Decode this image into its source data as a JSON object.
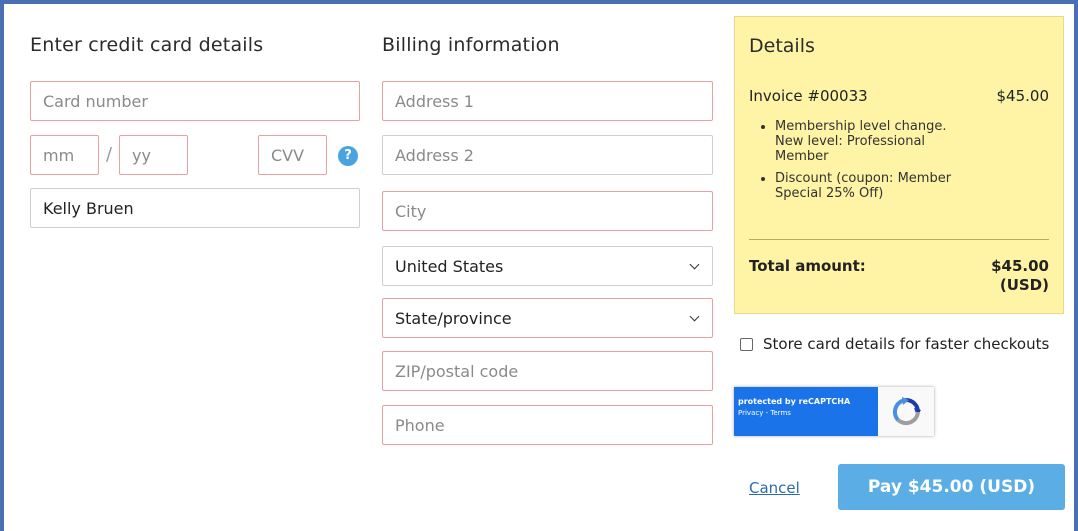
{
  "card_section": {
    "title": "Enter credit card details",
    "card_number_placeholder": "Card number",
    "month_placeholder": "mm",
    "separator": "/",
    "year_placeholder": "yy",
    "cvv_placeholder": "CVV",
    "help_glyph": "?",
    "cardholder_name_value": "Kelly Bruen"
  },
  "billing_section": {
    "title": "Billing information",
    "address1_placeholder": "Address 1",
    "address2_placeholder": "Address 2",
    "city_placeholder": "City",
    "country_selected": "United States",
    "state_selected": "State/province",
    "zip_placeholder": "ZIP/postal code",
    "phone_placeholder": "Phone"
  },
  "details": {
    "title": "Details",
    "invoice_label": "Invoice #00033",
    "invoice_amount": "$45.00",
    "items": [
      "Membership level change. New level: Professional Member",
      "Discount (coupon: Member Special 25% Off)"
    ],
    "total_label": "Total amount:",
    "total_amount": "$45.00",
    "total_currency": "(USD)",
    "background_color": "#fff3a5"
  },
  "store_card_label": "Store card details for faster checkouts",
  "recaptcha": {
    "protected_text": "protected by reCAPTCHA",
    "links_text": "Privacy - Terms"
  },
  "actions": {
    "cancel_label": "Cancel",
    "pay_label": "Pay $45.00 (USD)",
    "pay_color": "#5aaee5"
  },
  "icons": {
    "help": "help-icon",
    "chevron": "chevron-down-icon",
    "recaptcha": "recaptcha-logo-icon"
  },
  "colors": {
    "frame": "#4b6fb3",
    "invalid_border": "#e8a0a0",
    "link": "#2b6cb0"
  }
}
